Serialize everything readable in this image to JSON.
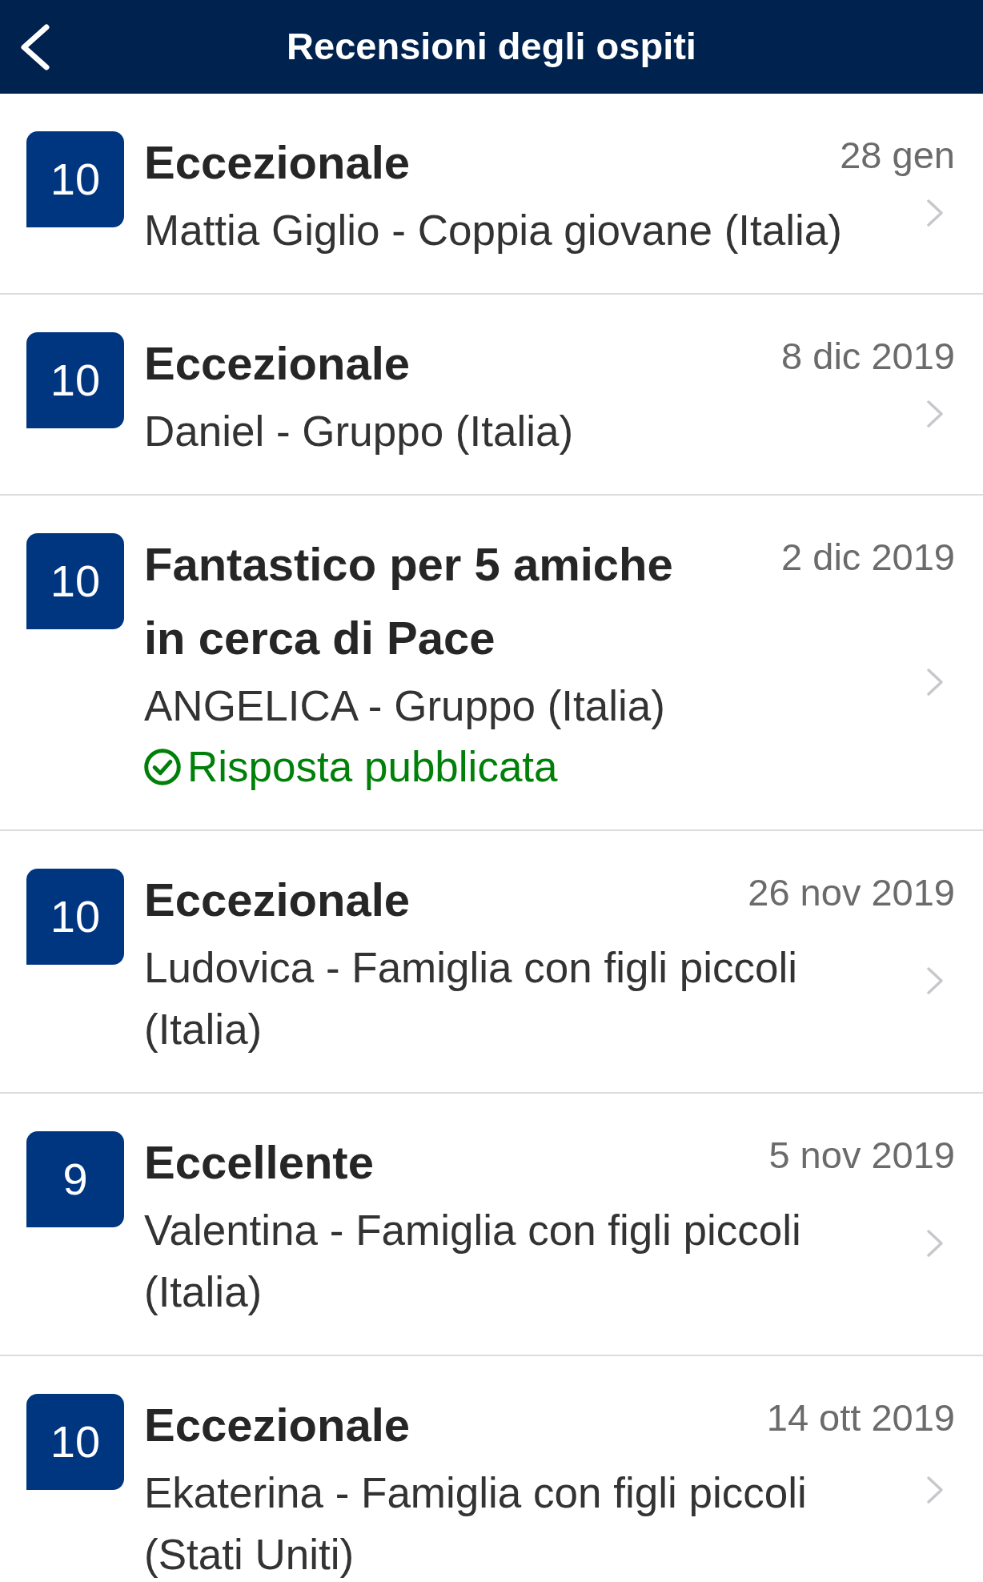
{
  "header": {
    "title": "Recensioni degli ospiti"
  },
  "reviews": [
    {
      "score": "10",
      "title": "Eccezionale",
      "date": "28 gen",
      "reviewer": "Mattia Giglio - Coppia giovane (Italia)"
    },
    {
      "score": "10",
      "title": "Eccezionale",
      "date": "8 dic 2019",
      "reviewer": "Daniel - Gruppo (Italia)"
    },
    {
      "score": "10",
      "title": "Fantastico per 5 amiche in cerca di Pace",
      "date": "2 dic 2019",
      "reviewer": "ANGELICA - Gruppo (Italia)",
      "response": "Risposta pubblicata"
    },
    {
      "score": "10",
      "title": "Eccezionale",
      "date": "26 nov 2019",
      "reviewer": "Ludovica - Famiglia con figli piccoli (Italia)"
    },
    {
      "score": "9",
      "title": "Eccellente",
      "date": "5 nov 2019",
      "reviewer": "Valentina - Famiglia con figli piccoli (Italia)"
    },
    {
      "score": "10",
      "title": "Eccezionale",
      "date": "14 ott 2019",
      "reviewer": "Ekaterina - Famiglia con figli piccoli (Stati Uniti)"
    }
  ]
}
